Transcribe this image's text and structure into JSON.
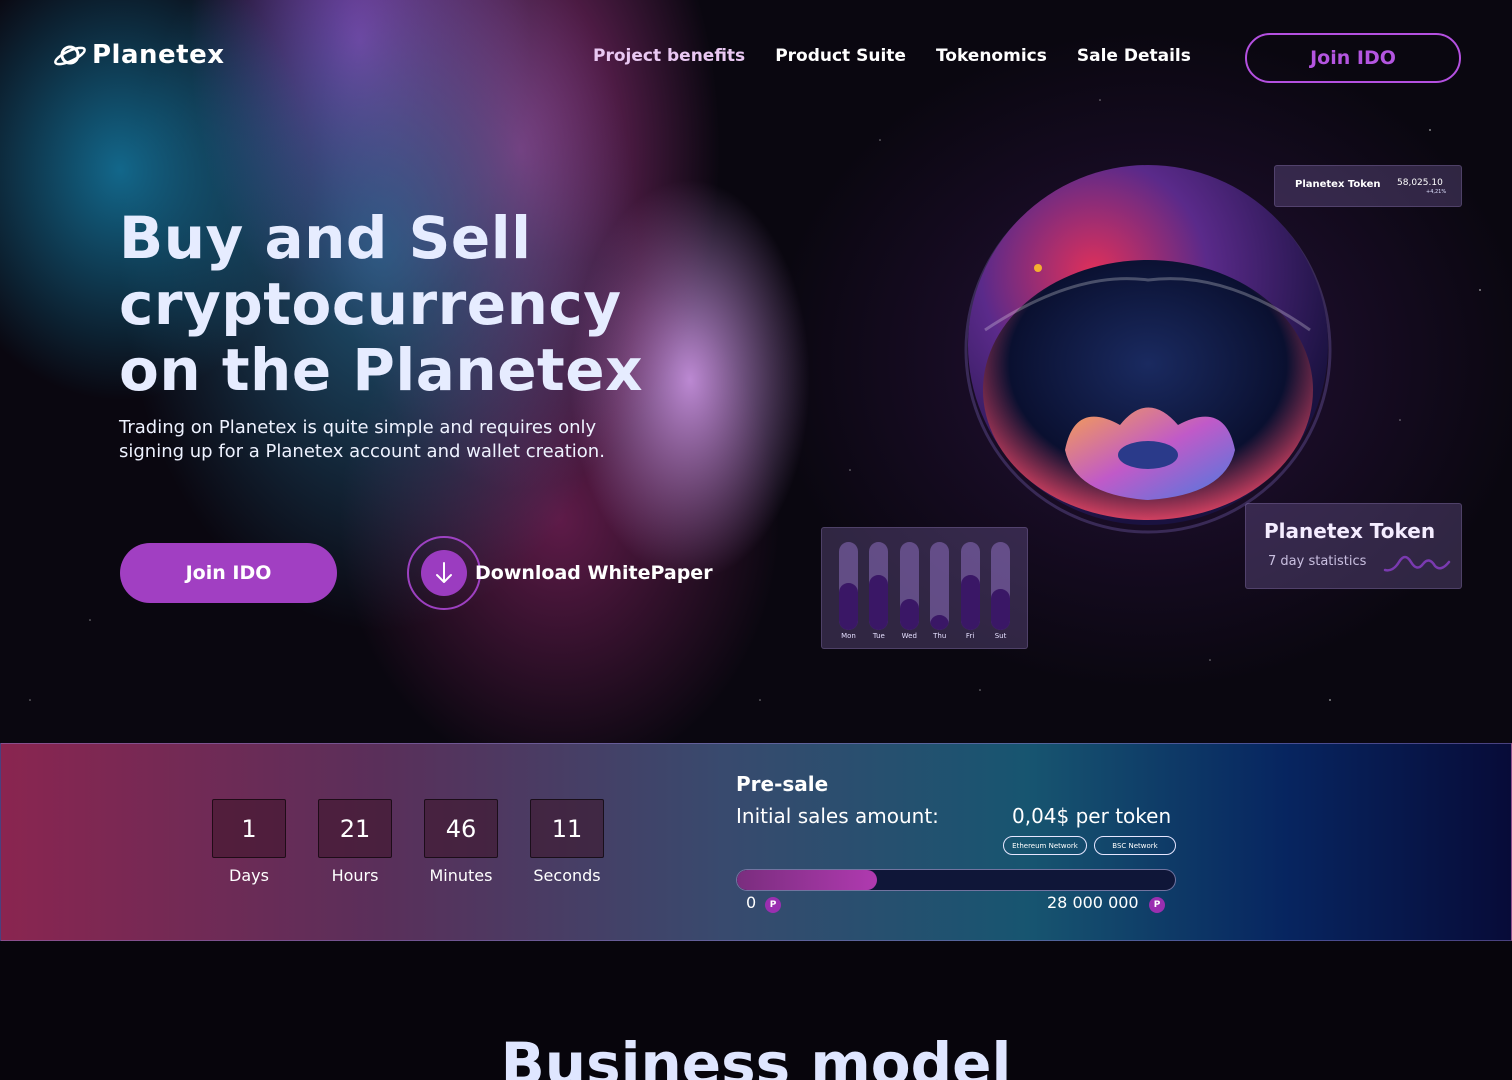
{
  "brand": {
    "name": "Planetex",
    "accent": "#a13fc2"
  },
  "nav": {
    "items": [
      {
        "label": "Project benefits"
      },
      {
        "label": "Product Suite"
      },
      {
        "label": "Tokenomics"
      },
      {
        "label": "Sale Details"
      }
    ],
    "cta": "Join IDO"
  },
  "hero": {
    "headline_lines": [
      "Buy and Sell",
      "cryptocurrency",
      "on the Planetex"
    ],
    "subtext": "Trading on Planetex is quite simple and requires only signing up for a Planetex account and wallet creation.",
    "join_button": "Join IDO",
    "download_label": "Download WhitePaper"
  },
  "token_card_small": {
    "name": "Planetex Token",
    "value": "58,025.10",
    "change": "+4,21%"
  },
  "token_card_big": {
    "title": "Planetex Token",
    "subtitle": "7 day statistics"
  },
  "weekly_bars": {
    "days": [
      "Mon",
      "Tue",
      "Wed",
      "Thu",
      "Fri",
      "Sut"
    ],
    "values": [
      0.53,
      0.62,
      0.35,
      0.17,
      0.63,
      0.47
    ]
  },
  "countdown": {
    "units": [
      {
        "value": "1",
        "label": "Days"
      },
      {
        "value": "21",
        "label": "Hours"
      },
      {
        "value": "46",
        "label": "Minutes"
      },
      {
        "value": "11",
        "label": "Seconds"
      }
    ]
  },
  "presale": {
    "title": "Pre-sale",
    "amount_label": "Initial sales amount:",
    "amount_value": "0,04$ per token",
    "networks": [
      "Ethereum Network",
      "BSC Network"
    ],
    "progress": 0.32,
    "min": "0",
    "max": "28 000 000",
    "coin_symbol": "P"
  },
  "section": {
    "business_model_title": "Business model"
  }
}
